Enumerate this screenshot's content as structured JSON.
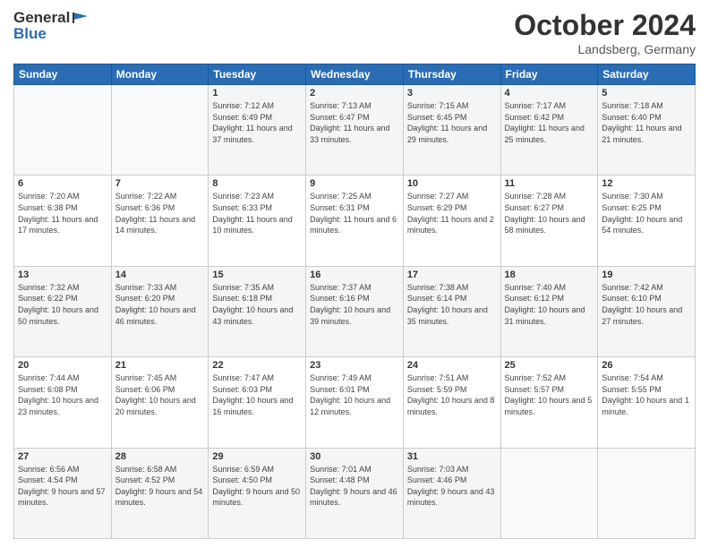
{
  "header": {
    "logo_general": "General",
    "logo_blue": "Blue",
    "month_title": "October 2024",
    "location": "Landsberg, Germany"
  },
  "days_of_week": [
    "Sunday",
    "Monday",
    "Tuesday",
    "Wednesday",
    "Thursday",
    "Friday",
    "Saturday"
  ],
  "weeks": [
    [
      {
        "day": "",
        "sunrise": "",
        "sunset": "",
        "daylight": ""
      },
      {
        "day": "",
        "sunrise": "",
        "sunset": "",
        "daylight": ""
      },
      {
        "day": "1",
        "sunrise": "Sunrise: 7:12 AM",
        "sunset": "Sunset: 6:49 PM",
        "daylight": "Daylight: 11 hours and 37 minutes."
      },
      {
        "day": "2",
        "sunrise": "Sunrise: 7:13 AM",
        "sunset": "Sunset: 6:47 PM",
        "daylight": "Daylight: 11 hours and 33 minutes."
      },
      {
        "day": "3",
        "sunrise": "Sunrise: 7:15 AM",
        "sunset": "Sunset: 6:45 PM",
        "daylight": "Daylight: 11 hours and 29 minutes."
      },
      {
        "day": "4",
        "sunrise": "Sunrise: 7:17 AM",
        "sunset": "Sunset: 6:42 PM",
        "daylight": "Daylight: 11 hours and 25 minutes."
      },
      {
        "day": "5",
        "sunrise": "Sunrise: 7:18 AM",
        "sunset": "Sunset: 6:40 PM",
        "daylight": "Daylight: 11 hours and 21 minutes."
      }
    ],
    [
      {
        "day": "6",
        "sunrise": "Sunrise: 7:20 AM",
        "sunset": "Sunset: 6:38 PM",
        "daylight": "Daylight: 11 hours and 17 minutes."
      },
      {
        "day": "7",
        "sunrise": "Sunrise: 7:22 AM",
        "sunset": "Sunset: 6:36 PM",
        "daylight": "Daylight: 11 hours and 14 minutes."
      },
      {
        "day": "8",
        "sunrise": "Sunrise: 7:23 AM",
        "sunset": "Sunset: 6:33 PM",
        "daylight": "Daylight: 11 hours and 10 minutes."
      },
      {
        "day": "9",
        "sunrise": "Sunrise: 7:25 AM",
        "sunset": "Sunset: 6:31 PM",
        "daylight": "Daylight: 11 hours and 6 minutes."
      },
      {
        "day": "10",
        "sunrise": "Sunrise: 7:27 AM",
        "sunset": "Sunset: 6:29 PM",
        "daylight": "Daylight: 11 hours and 2 minutes."
      },
      {
        "day": "11",
        "sunrise": "Sunrise: 7:28 AM",
        "sunset": "Sunset: 6:27 PM",
        "daylight": "Daylight: 10 hours and 58 minutes."
      },
      {
        "day": "12",
        "sunrise": "Sunrise: 7:30 AM",
        "sunset": "Sunset: 6:25 PM",
        "daylight": "Daylight: 10 hours and 54 minutes."
      }
    ],
    [
      {
        "day": "13",
        "sunrise": "Sunrise: 7:32 AM",
        "sunset": "Sunset: 6:22 PM",
        "daylight": "Daylight: 10 hours and 50 minutes."
      },
      {
        "day": "14",
        "sunrise": "Sunrise: 7:33 AM",
        "sunset": "Sunset: 6:20 PM",
        "daylight": "Daylight: 10 hours and 46 minutes."
      },
      {
        "day": "15",
        "sunrise": "Sunrise: 7:35 AM",
        "sunset": "Sunset: 6:18 PM",
        "daylight": "Daylight: 10 hours and 43 minutes."
      },
      {
        "day": "16",
        "sunrise": "Sunrise: 7:37 AM",
        "sunset": "Sunset: 6:16 PM",
        "daylight": "Daylight: 10 hours and 39 minutes."
      },
      {
        "day": "17",
        "sunrise": "Sunrise: 7:38 AM",
        "sunset": "Sunset: 6:14 PM",
        "daylight": "Daylight: 10 hours and 35 minutes."
      },
      {
        "day": "18",
        "sunrise": "Sunrise: 7:40 AM",
        "sunset": "Sunset: 6:12 PM",
        "daylight": "Daylight: 10 hours and 31 minutes."
      },
      {
        "day": "19",
        "sunrise": "Sunrise: 7:42 AM",
        "sunset": "Sunset: 6:10 PM",
        "daylight": "Daylight: 10 hours and 27 minutes."
      }
    ],
    [
      {
        "day": "20",
        "sunrise": "Sunrise: 7:44 AM",
        "sunset": "Sunset: 6:08 PM",
        "daylight": "Daylight: 10 hours and 23 minutes."
      },
      {
        "day": "21",
        "sunrise": "Sunrise: 7:45 AM",
        "sunset": "Sunset: 6:06 PM",
        "daylight": "Daylight: 10 hours and 20 minutes."
      },
      {
        "day": "22",
        "sunrise": "Sunrise: 7:47 AM",
        "sunset": "Sunset: 6:03 PM",
        "daylight": "Daylight: 10 hours and 16 minutes."
      },
      {
        "day": "23",
        "sunrise": "Sunrise: 7:49 AM",
        "sunset": "Sunset: 6:01 PM",
        "daylight": "Daylight: 10 hours and 12 minutes."
      },
      {
        "day": "24",
        "sunrise": "Sunrise: 7:51 AM",
        "sunset": "Sunset: 5:59 PM",
        "daylight": "Daylight: 10 hours and 8 minutes."
      },
      {
        "day": "25",
        "sunrise": "Sunrise: 7:52 AM",
        "sunset": "Sunset: 5:57 PM",
        "daylight": "Daylight: 10 hours and 5 minutes."
      },
      {
        "day": "26",
        "sunrise": "Sunrise: 7:54 AM",
        "sunset": "Sunset: 5:55 PM",
        "daylight": "Daylight: 10 hours and 1 minute."
      }
    ],
    [
      {
        "day": "27",
        "sunrise": "Sunrise: 6:56 AM",
        "sunset": "Sunset: 4:54 PM",
        "daylight": "Daylight: 9 hours and 57 minutes."
      },
      {
        "day": "28",
        "sunrise": "Sunrise: 6:58 AM",
        "sunset": "Sunset: 4:52 PM",
        "daylight": "Daylight: 9 hours and 54 minutes."
      },
      {
        "day": "29",
        "sunrise": "Sunrise: 6:59 AM",
        "sunset": "Sunset: 4:50 PM",
        "daylight": "Daylight: 9 hours and 50 minutes."
      },
      {
        "day": "30",
        "sunrise": "Sunrise: 7:01 AM",
        "sunset": "Sunset: 4:48 PM",
        "daylight": "Daylight: 9 hours and 46 minutes."
      },
      {
        "day": "31",
        "sunrise": "Sunrise: 7:03 AM",
        "sunset": "Sunset: 4:46 PM",
        "daylight": "Daylight: 9 hours and 43 minutes."
      },
      {
        "day": "",
        "sunrise": "",
        "sunset": "",
        "daylight": ""
      },
      {
        "day": "",
        "sunrise": "",
        "sunset": "",
        "daylight": ""
      }
    ]
  ]
}
